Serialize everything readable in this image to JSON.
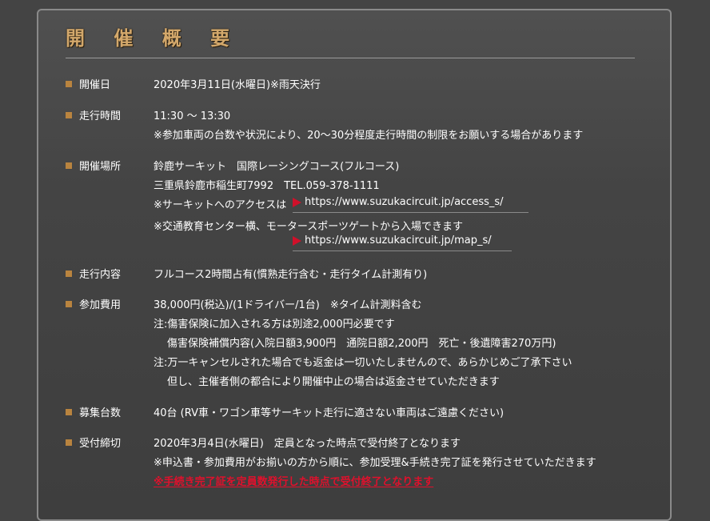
{
  "title": "開 催 概 要",
  "rows": {
    "date": {
      "label": "開催日",
      "lines": [
        "2020年3月11日(水曜日)※雨天決行"
      ]
    },
    "time": {
      "label": "走行時間",
      "lines": [
        "11:30 〜 13:30",
        "※参加車両の台数や状況により、20〜30分程度走行時間の制限をお願いする場合があります"
      ]
    },
    "venue": {
      "label": "開催場所",
      "lines": [
        "鈴鹿サーキット　国際レーシングコース(フルコース)",
        "三重県鈴鹿市稲生町7992　TEL.059-378-1111"
      ],
      "access_note": "※サーキットへのアクセスは",
      "access_link": "https://www.suzukacircuit.jp/access_s/",
      "entry_note": "※交通教育センター横、モータースポーツゲートから入場できます",
      "map_link": "https://www.suzukacircuit.jp/map_s/"
    },
    "content": {
      "label": "走行内容",
      "lines": [
        "フルコース2時間占有(慣熟走行含む・走行タイム計測有り)"
      ]
    },
    "fee": {
      "label": "参加費用",
      "lines": [
        "38,000円(税込)/(1ドライバー/1台)　※タイム計測料含む",
        "注:傷害保険に加入される方は別途2,000円必要です",
        "傷害保険補償内容(入院日額3,900円　通院日額2,200円　死亡・後遺障害270万円)",
        "注:万一キャンセルされた場合でも返金は一切いたしませんので、あらかじめご了承下さい",
        "但し、主催者側の都合により開催中止の場合は返金させていただきます"
      ]
    },
    "capacity": {
      "label": "募集台数",
      "lines": [
        "40台 (RV車・ワゴン車等サーキット走行に適さない車両はご遠慮ください)"
      ]
    },
    "deadline": {
      "label": "受付締切",
      "lines": [
        "2020年3月4日(水曜日)　定員となった時点で受付終了となります",
        "※申込書・参加費用がお揃いの方から順に、参加受理&手続き完了証を発行させていただきます"
      ],
      "warning": "※手続き完了証を定員数発行した時点で受付終了となります"
    }
  },
  "colors": {
    "title": "#d3a86b",
    "bullet": "#b9843f",
    "arrow": "#d0102a",
    "warning": "#e0102c"
  }
}
